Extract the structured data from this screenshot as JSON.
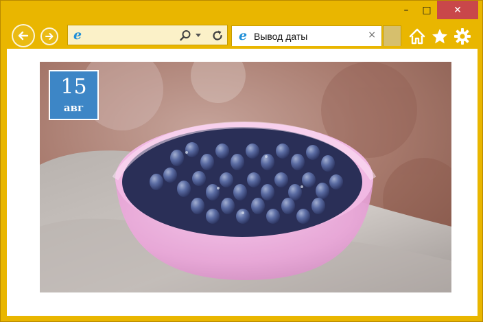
{
  "window": {
    "controls": {
      "minimize": "–",
      "maximize": "□",
      "close": "✕"
    }
  },
  "toolbar": {
    "tab_title": "Вывод даты",
    "tab_close": "×"
  },
  "icons": {
    "ie_logo": "e"
  },
  "page": {
    "date_day": "15",
    "date_month": "авг"
  },
  "colors": {
    "chrome": "#e9b600",
    "badge_bg": "#3d86c6",
    "close_btn": "#c9474a"
  }
}
